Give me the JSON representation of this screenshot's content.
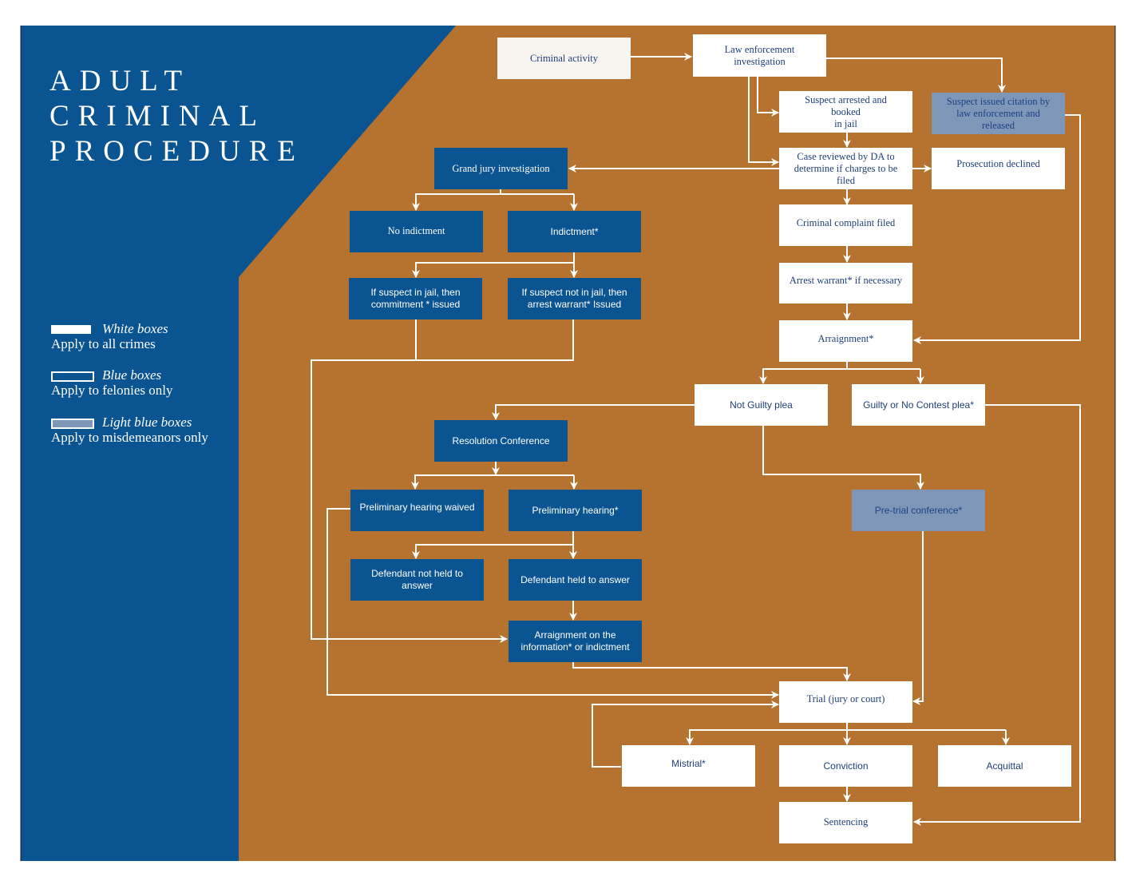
{
  "title_lines": [
    "ADULT",
    "CRIMINAL",
    "PROCEDURE"
  ],
  "colors": {
    "blue_panel": "#0a5491",
    "orange_background": "#b5732f",
    "white_box": "#ffffff",
    "light_blue_box": "#7e97b8",
    "box_text_dark": "#1f3f7a",
    "connector": "#ffffff"
  },
  "legend": [
    {
      "name": "White boxes",
      "description": "Apply to all crimes"
    },
    {
      "name": "Blue boxes",
      "description": "Apply to felonies only"
    },
    {
      "name": "Light blue boxes",
      "description": "Apply to misdemeanors only"
    }
  ],
  "nodes": {
    "criminal_activity": "Criminal activity",
    "law_enforcement_investigation": "Law enforcement investigation",
    "suspect_arrested": "Suspect arrested and booked in jail",
    "suspect_citation": "Suspect issued citation by law enforcement and released",
    "case_reviewed": "Case reviewed by DA to determine if charges to be filed",
    "prosecution_declined": "Prosecution declined",
    "grand_jury": "Grand jury investigation",
    "no_indictment": "No indictment",
    "indictment": "Indictment*",
    "commitment_issued": "If suspect in jail, then commitment * issued",
    "arrest_warrant_issued": "If suspect not in jail, then arrest warrant* Issued",
    "criminal_complaint": "Criminal complaint filed",
    "arrest_warrant": "Arrest warrant* if necessary",
    "arraignment": "Arraignment*",
    "not_guilty_plea": "Not Guilty plea",
    "guilty_plea": "Guilty or No Contest plea*",
    "resolution_conference": "Resolution Conference",
    "prelim_waived": "Preliminary hearing waived",
    "prelim_hearing": "Preliminary hearing*",
    "not_held": "Defendant  not held to answer",
    "held": "Defendant held to answer",
    "arraignment_info": "Arraignment on the information* or indictment",
    "pretrial_conference": "Pre-trial conference*",
    "trial": "Trial  (jury or court)",
    "mistrial": "Mistrial*",
    "conviction": "Conviction",
    "acquittal": "Acquittal",
    "sentencing": "Sentencing"
  },
  "node_lines": {
    "law_enforcement_investigation": [
      "Law enforcement",
      "investigation"
    ],
    "suspect_arrested": [
      "Suspect arrested and",
      "booked",
      "in jail"
    ],
    "suspect_citation": [
      "Suspect issued citation by",
      "law enforcement and",
      "released"
    ],
    "case_reviewed": [
      "Case reviewed by DA to",
      "determine if charges to be",
      "filed"
    ],
    "commitment_issued": [
      "If suspect in jail, then",
      "commitment * issued"
    ],
    "arrest_warrant_issued": [
      "If suspect not in jail, then",
      "arrest warrant* Issued"
    ],
    "not_held": [
      "Defendant  not held to",
      "answer"
    ],
    "arraignment_info": [
      "Arraignment on the",
      "information* or indictment"
    ]
  },
  "edges": [
    [
      "criminal_activity",
      "law_enforcement_investigation"
    ],
    [
      "law_enforcement_investigation",
      "suspect_citation"
    ],
    [
      "law_enforcement_investigation",
      "suspect_arrested"
    ],
    [
      "law_enforcement_investigation",
      "case_reviewed"
    ],
    [
      "suspect_arrested",
      "case_reviewed"
    ],
    [
      "case_reviewed",
      "grand_jury"
    ],
    [
      "case_reviewed",
      "prosecution_declined"
    ],
    [
      "case_reviewed",
      "criminal_complaint"
    ],
    [
      "suspect_citation",
      "arraignment"
    ],
    [
      "grand_jury",
      "no_indictment"
    ],
    [
      "grand_jury",
      "indictment"
    ],
    [
      "indictment",
      "commitment_issued"
    ],
    [
      "indictment",
      "arrest_warrant_issued"
    ],
    [
      "commitment_issued",
      "arraignment_info"
    ],
    [
      "arrest_warrant_issued",
      "arraignment_info"
    ],
    [
      "criminal_complaint",
      "arrest_warrant"
    ],
    [
      "arrest_warrant",
      "arraignment"
    ],
    [
      "arraignment",
      "not_guilty_plea"
    ],
    [
      "arraignment",
      "guilty_plea"
    ],
    [
      "not_guilty_plea",
      "resolution_conference"
    ],
    [
      "not_guilty_plea",
      "pretrial_conference"
    ],
    [
      "guilty_plea",
      "sentencing"
    ],
    [
      "resolution_conference",
      "prelim_waived"
    ],
    [
      "resolution_conference",
      "prelim_hearing"
    ],
    [
      "prelim_hearing",
      "not_held"
    ],
    [
      "prelim_hearing",
      "held"
    ],
    [
      "held",
      "arraignment_info"
    ],
    [
      "prelim_waived",
      "trial"
    ],
    [
      "arraignment_info",
      "trial"
    ],
    [
      "pretrial_conference",
      "trial"
    ],
    [
      "trial",
      "mistrial"
    ],
    [
      "trial",
      "conviction"
    ],
    [
      "trial",
      "acquittal"
    ],
    [
      "mistrial",
      "trial"
    ],
    [
      "conviction",
      "sentencing"
    ]
  ]
}
